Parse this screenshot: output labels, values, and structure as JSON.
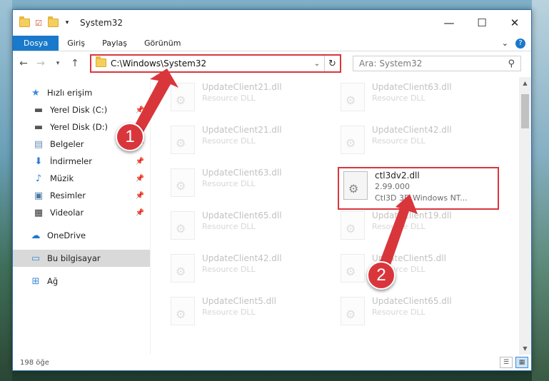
{
  "window": {
    "title": "System32",
    "controls": {
      "minimize": "—",
      "maximize": "☐",
      "close": "✕"
    }
  },
  "ribbon": {
    "tabs": [
      "Dosya",
      "Giriş",
      "Paylaş",
      "Görünüm"
    ],
    "expand": "⌄",
    "help": "?"
  },
  "address": {
    "path": "C:\\Windows\\System32",
    "search_placeholder": "Ara: System32"
  },
  "nav": {
    "quick_access": "Hızlı erişim",
    "items": [
      {
        "label": "Yerel Disk (C:)",
        "icon": "drive-icon",
        "pinned": true
      },
      {
        "label": "Yerel Disk (D:)",
        "icon": "drive-icon",
        "pinned": true
      },
      {
        "label": "Belgeler",
        "icon": "documents-icon",
        "pinned": true
      },
      {
        "label": "İndirmeler",
        "icon": "downloads-icon",
        "pinned": true
      },
      {
        "label": "Müzik",
        "icon": "music-icon",
        "pinned": true
      },
      {
        "label": "Resimler",
        "icon": "pictures-icon",
        "pinned": true
      },
      {
        "label": "Videolar",
        "icon": "videos-icon",
        "pinned": true
      }
    ],
    "onedrive": "OneDrive",
    "this_pc": "Bu bilgisayar",
    "network": "Ağ"
  },
  "files": {
    "left_column": [
      {
        "name": "UpdateClient21.dll",
        "type": "Resource DLL"
      },
      {
        "name": "UpdateClient21.dll",
        "type": "Resource DLL"
      },
      {
        "name": "UpdateClient63.dll",
        "type": "Resource DLL"
      },
      {
        "name": "UpdateClient65.dll",
        "type": "Resource DLL"
      },
      {
        "name": "UpdateClient42.dll",
        "type": "Resource DLL"
      },
      {
        "name": "UpdateClient5.dll",
        "type": "Resource DLL"
      }
    ],
    "right_column": [
      {
        "name": "UpdateClient63.dll",
        "type": "Resource DLL"
      },
      {
        "name": "UpdateClient42.dll",
        "type": "Resource DLL"
      },
      {
        "name": "UpdateClient19.dll",
        "type": "Resource DLL"
      },
      {
        "name": "UpdateClient5.dll",
        "type": "Resource DLL"
      },
      {
        "name": "UpdateClient65.dll",
        "type": "Resource DLL"
      }
    ],
    "highlighted": {
      "name": "ctl3dv2.dll",
      "version": "2.99.000",
      "description": "Ctl3D 3D Windows NT..."
    }
  },
  "status": {
    "count": "198 öğe"
  },
  "callouts": [
    "1",
    "2"
  ],
  "colors": {
    "accent": "#1979ca",
    "highlight": "#d9363c"
  }
}
